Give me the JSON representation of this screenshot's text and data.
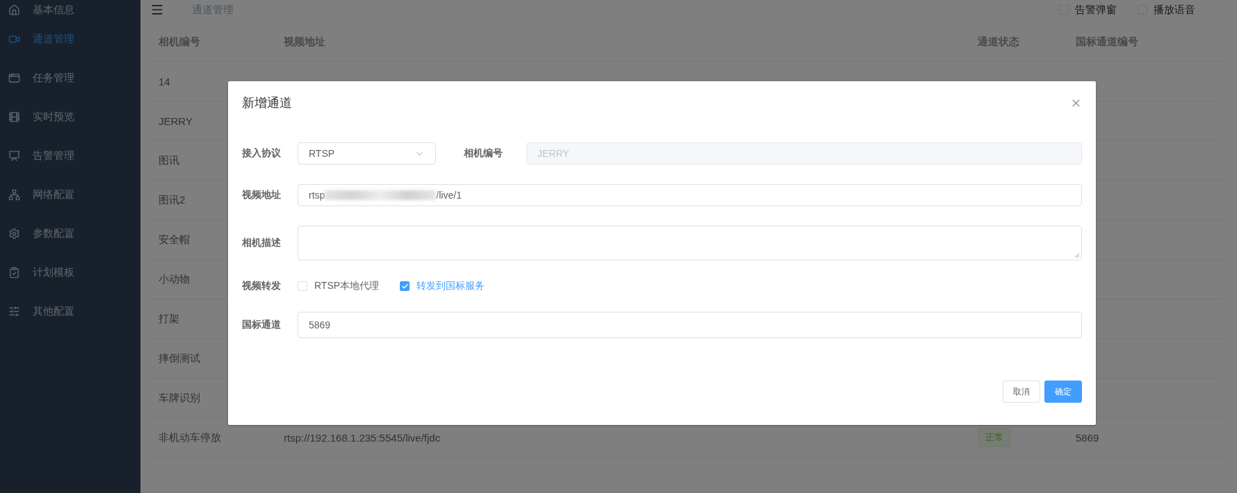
{
  "sidebar": {
    "items": [
      {
        "label": "基本信息",
        "selected": false
      },
      {
        "label": "通道管理",
        "selected": true
      },
      {
        "label": "任务管理",
        "selected": false
      },
      {
        "label": "实时预览",
        "selected": false
      },
      {
        "label": "告警管理",
        "selected": false
      },
      {
        "label": "网络配置",
        "selected": false
      },
      {
        "label": "参数配置",
        "selected": false
      },
      {
        "label": "计划模板",
        "selected": false
      },
      {
        "label": "其他配置",
        "selected": false
      }
    ]
  },
  "header": {
    "breadcrumb": "通道管理",
    "toggles": [
      {
        "label": "告警弹窗",
        "checked": false
      },
      {
        "label": "播放语音",
        "checked": false
      }
    ]
  },
  "table": {
    "columns": [
      "相机编号",
      "视频地址",
      "通道状态",
      "国标通道编号"
    ],
    "rows": [
      {
        "camera": "14"
      },
      {
        "camera": "JERRY"
      },
      {
        "camera": "图讯"
      },
      {
        "camera": "图讯2"
      },
      {
        "camera": "安全帽"
      },
      {
        "camera": "小动物"
      },
      {
        "camera": "打架"
      },
      {
        "camera": "摔倒测试"
      },
      {
        "camera": "车牌识别"
      },
      {
        "camera": "非机动车停放",
        "url": "rtsp://192.168.1.235:5545/live/fjdc",
        "status": {
          "text": "正常",
          "kind": "success"
        },
        "gb_channel": "5869"
      }
    ]
  },
  "dialog": {
    "title": "新增通道",
    "protocol": {
      "label": "接入协议",
      "value": "RTSP"
    },
    "camera_id": {
      "label": "相机编号",
      "value": "JERRY",
      "disabled": true
    },
    "video_url": {
      "label": "视频地址",
      "value_start": "rtsp",
      "redacted": true,
      "value_end": "/live/1"
    },
    "description": {
      "label": "相机描述"
    },
    "forwarding": {
      "label": "视频转发",
      "options": [
        {
          "label": "RTSP本地代理",
          "checked": false
        },
        {
          "label": "转发到国标服务",
          "checked": true
        }
      ]
    },
    "gb_channel": {
      "label": "国标通道",
      "value": "5869"
    },
    "buttons": [
      {
        "label": "取消",
        "kind": "default"
      },
      {
        "label": "确定",
        "kind": "primary"
      }
    ]
  }
}
